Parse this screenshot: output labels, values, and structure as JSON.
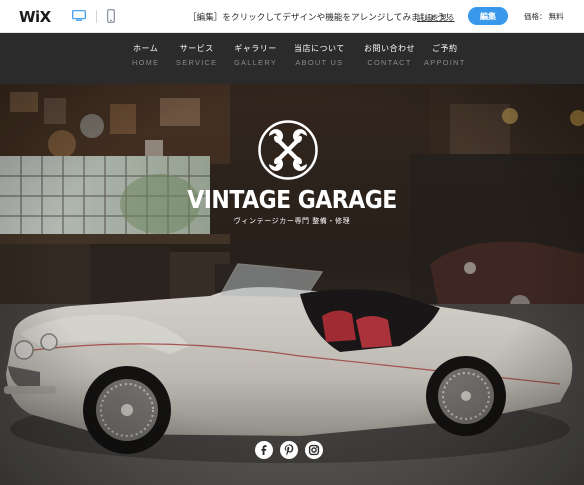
{
  "editor_bar": {
    "logo": "WiX",
    "promo_text": "［編集］をクリックしてデザインや機能をアレンジしてみましょう！",
    "details_link": "詳細を見る",
    "edit_button": "編集",
    "price": "価格： 無料",
    "icons": {
      "desktop": "desktop-icon",
      "mobile": "mobile-icon"
    },
    "accent_color": "#3899ec"
  },
  "site_nav": {
    "items": [
      {
        "jp": "ホーム",
        "en": "HOME"
      },
      {
        "jp": "サービス",
        "en": "SERVICE"
      },
      {
        "jp": "ギャラリー",
        "en": "GALLERY"
      },
      {
        "jp": "当店について",
        "en": "ABOUT US"
      },
      {
        "jp": "お問い合わせ",
        "en": "CONTACT"
      },
      {
        "jp": "ご予約",
        "en": "APPOINT"
      }
    ],
    "background": "#2b2b2b"
  },
  "hero": {
    "title": "VINTAGE GARAGE",
    "subtitle": "ヴィンテージカー専門 整備・修理",
    "emblem_icon": "crossed-wrenches-icon",
    "social_icons": [
      "facebook-icon",
      "pinterest-icon",
      "instagram-icon"
    ]
  }
}
